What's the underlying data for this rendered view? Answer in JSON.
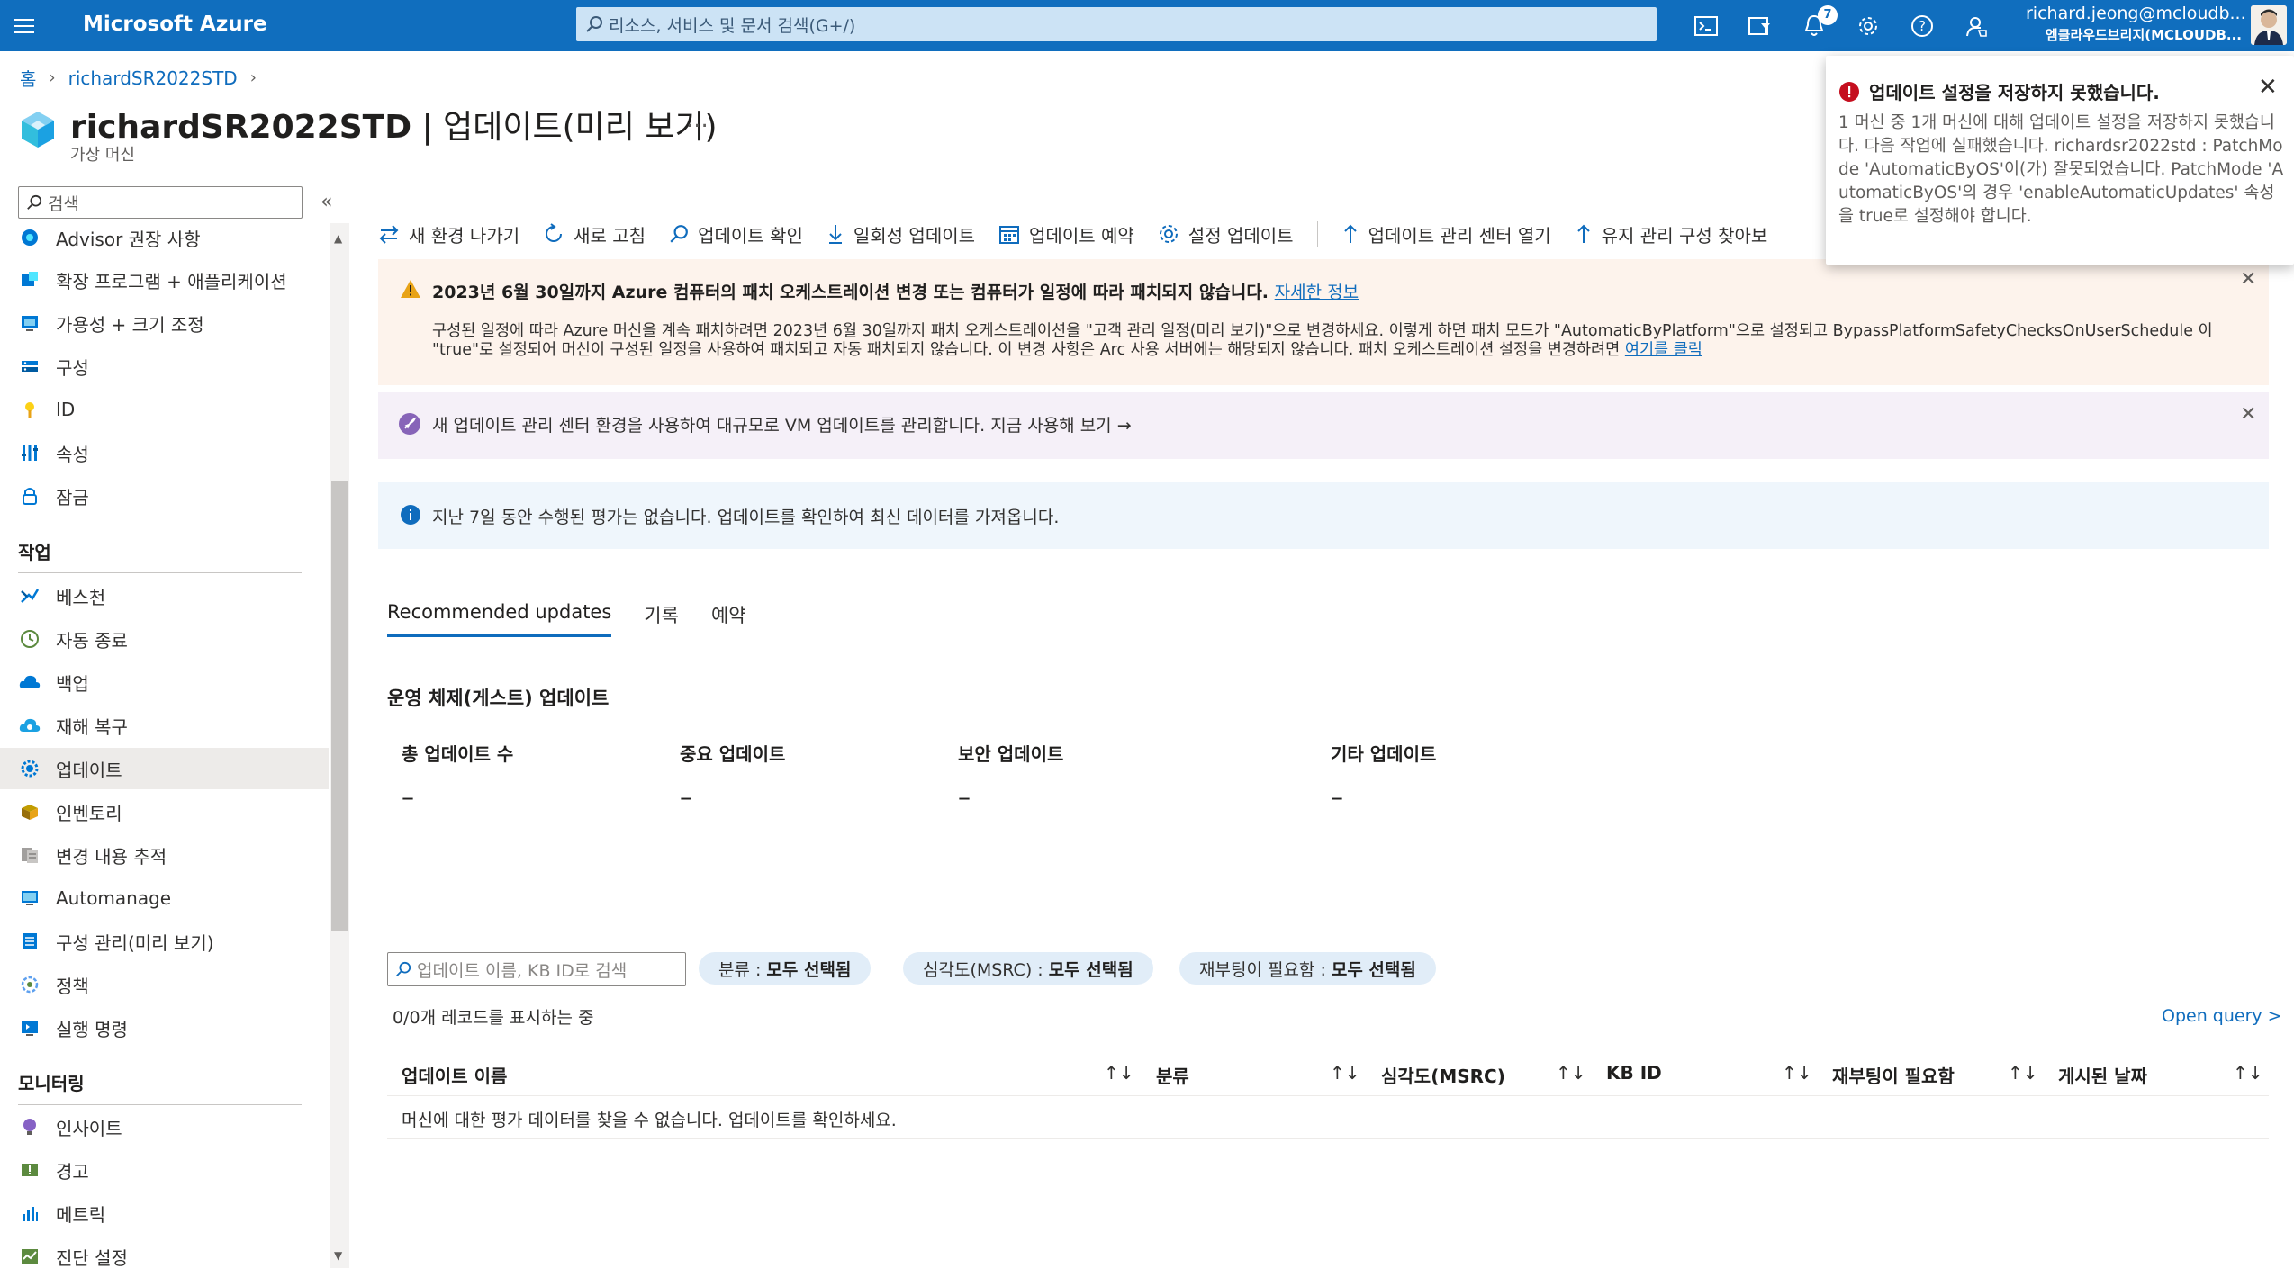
{
  "header": {
    "brand": "Microsoft Azure",
    "search_placeholder": "리소스, 서비스 및 문서 검색(G+/)",
    "notification_count": "7",
    "user_name": "richard.jeong@mcloudb...",
    "user_org": "엠클라우드브리지(MCLOUDB..."
  },
  "breadcrumb": {
    "home": "홈",
    "resource": "richardSR2022STD"
  },
  "page": {
    "title_main": "richardSR2022STD",
    "title_rest": " | 업데이트(미리 보기)",
    "more": "...",
    "subtitle": "가상 머신"
  },
  "sidebar": {
    "search_placeholder": "검색",
    "collapse": "«",
    "items_top": [
      {
        "label": "Advisor 권장 사항",
        "icon": "advisor-icon"
      },
      {
        "label": "확장 프로그램 + 애플리케이션",
        "icon": "extensions-icon"
      },
      {
        "label": "가용성 + 크기 조정",
        "icon": "availability-icon"
      },
      {
        "label": "구성",
        "icon": "configuration-icon"
      },
      {
        "label": "ID",
        "icon": "identity-icon"
      },
      {
        "label": "속성",
        "icon": "properties-icon"
      },
      {
        "label": "잠금",
        "icon": "lock-icon"
      }
    ],
    "section_ops": "작업",
    "items_ops": [
      {
        "label": "베스천",
        "icon": "bastion-icon"
      },
      {
        "label": "자동 종료",
        "icon": "clock-icon"
      },
      {
        "label": "백업",
        "icon": "backup-icon"
      },
      {
        "label": "재해 복구",
        "icon": "disaster-recovery-icon"
      },
      {
        "label": "업데이트",
        "icon": "updates-gear-icon"
      },
      {
        "label": "인벤토리",
        "icon": "inventory-icon"
      },
      {
        "label": "변경 내용 추적",
        "icon": "change-tracking-icon"
      },
      {
        "label": "Automanage",
        "icon": "automanage-icon"
      },
      {
        "label": "구성 관리(미리 보기)",
        "icon": "config-management-icon"
      },
      {
        "label": "정책",
        "icon": "policy-icon"
      },
      {
        "label": "실행 명령",
        "icon": "run-command-icon"
      }
    ],
    "section_mon": "모니터링",
    "items_mon": [
      {
        "label": "인사이트",
        "icon": "insights-icon"
      },
      {
        "label": "경고",
        "icon": "alerts-icon"
      },
      {
        "label": "메트릭",
        "icon": "metrics-icon"
      },
      {
        "label": "진단 설정",
        "icon": "diagnostics-icon"
      }
    ]
  },
  "toolbar": {
    "new_experience": "새 환경 나가기",
    "refresh": "새로 고침",
    "check_updates": "업데이트 확인",
    "one_time_update": "일회성 업데이트",
    "schedule_updates": "업데이트 예약",
    "update_settings": "설정 업데이트",
    "open_center": "업데이트 관리 센터 열기",
    "maintenance": "유지 관리 구성 찾아보"
  },
  "warning": {
    "title": "2023년 6월 30일까지 Azure 컴퓨터의 패치 오케스트레이션 변경 또는 컴퓨터가 일정에 따라 패치되지 않습니다.",
    "title_link": "자세한 정보",
    "body": "구성된 일정에 따라 Azure 머신을 계속 패치하려면 2023년 6월 30일까지 패치 오케스트레이션을 \"고객 관리 일정(미리 보기)\"으로 변경하세요. 이렇게 하면 패치 모드가 \"AutomaticByPlatform\"으로 설정되고 BypassPlatformSafetyChecksOnUserSchedule 이 \"true\"로 설정되어 머신이 구성된 일정을 사용하여 패치되고 자동 패치되지 않습니다. 이 변경 사항은 Arc 사용 서버에는 해당되지 않습니다. 패치 오케스트레이션 설정을 변경하려면",
    "body_link": "여기를 클릭"
  },
  "promo": {
    "text": "새 업데이트 관리 센터 환경을 사용하여 대규모로 VM 업데이트를 관리합니다. 지금 사용해 보기 →"
  },
  "info": {
    "text": "지난 7일 동안 수행된 평가는 없습니다. 업데이트를 확인하여 최신 데이터를 가져옵니다."
  },
  "tabs": [
    "Recommended updates",
    "기록",
    "예약"
  ],
  "os_updates": {
    "title": "운영 체제(게스트) 업데이트",
    "stats": [
      {
        "label": "총 업데이트 수",
        "value": "–"
      },
      {
        "label": "중요 업데이트",
        "value": "–"
      },
      {
        "label": "보안 업데이트",
        "value": "–"
      },
      {
        "label": "기타 업데이트",
        "value": "–"
      }
    ]
  },
  "filters": {
    "search_placeholder": "업데이트 이름, KB ID로 검색",
    "pills": [
      {
        "key": "분류 : ",
        "value": "모두 선택됨"
      },
      {
        "key": "심각도(MSRC) : ",
        "value": "모두 선택됨"
      },
      {
        "key": "재부팅이 필요함 : ",
        "value": "모두 선택됨"
      }
    ],
    "record_count": "0/0개 레코드를 표시하는 중",
    "open_query": "Open query >"
  },
  "table": {
    "columns": [
      "업데이트 이름",
      "분류",
      "심각도(MSRC)",
      "KB ID",
      "재부팅이 필요함",
      "게시된 날짜"
    ],
    "empty_message": "머신에 대한 평가 데이터를 찾을 수 없습니다. 업데이트를 확인하세요."
  },
  "toast": {
    "title": "업데이트 설정을 저장하지 못했습니다.",
    "body": "1 머신 중 1개 머신에 대해 업데이트 설정을 저장하지 못했습니다. 다음 작업에 실패했습니다. richardsr2022std : PatchMode 'AutomaticByOS'이(가) 잘못되었습니다. PatchMode 'AutomaticByOS'의 경우 'enableAutomaticUpdates' 속성을 true로 설정해야 합니다."
  },
  "colors": {
    "accent": "#0f6cbd",
    "topbar": "#106ebe",
    "error": "#c50f1f",
    "warning": "#e8a317"
  }
}
